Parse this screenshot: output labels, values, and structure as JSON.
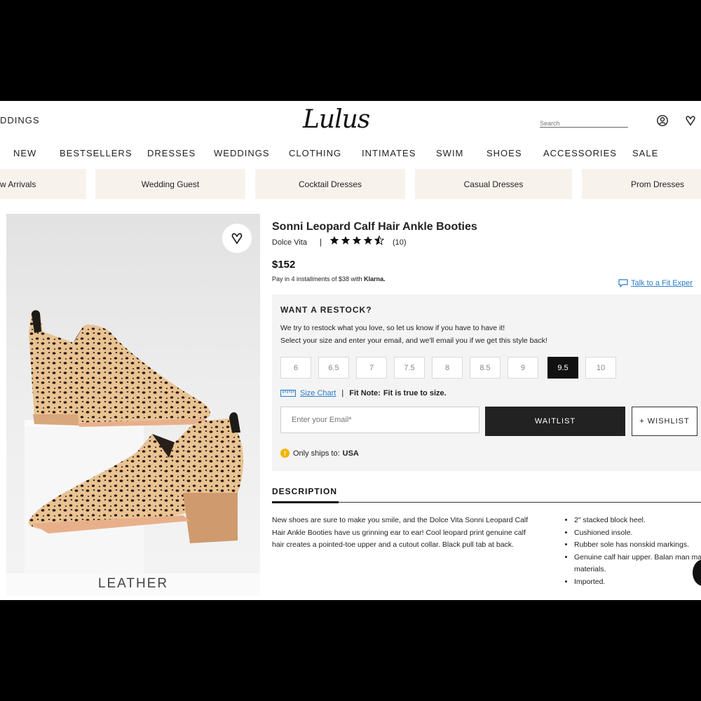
{
  "header": {
    "weddings_link": "DDINGS",
    "logo": "Lulus",
    "search_placeholder": "Search",
    "icons": [
      "account-icon",
      "heart-icon"
    ]
  },
  "nav": {
    "items": [
      "NEW",
      "BESTSELLERS",
      "DRESSES",
      "WEDDINGS",
      "CLOTHING",
      "INTIMATES",
      "SWIM",
      "SHOES",
      "ACCESSORIES",
      "SALE"
    ]
  },
  "chips": [
    "w Arrivals",
    "Wedding Guest",
    "Cocktail Dresses",
    "Casual Dresses",
    "Prom Dresses"
  ],
  "product": {
    "image_label": "LEATHER",
    "title": "Sonni Leopard Calf Hair Ankle Booties",
    "brand": "Dolce Vita",
    "separator": "|",
    "rating": 4.5,
    "review_count": "(10)",
    "price": "$152",
    "klarna_text": "Pay in 4 installments of $38 with",
    "klarna_brand": "Klarna.",
    "fit_expert": "Talk to a Fit Exper"
  },
  "restock": {
    "title": "WANT A RESTOCK?",
    "line1": "We try to restock what you love, so let us know if you have to have it!",
    "line2": "Select your size and enter your email, and we'll email you if we get this style back!",
    "sizes": [
      "6",
      "6.5",
      "7",
      "7.5",
      "8",
      "8.5",
      "9",
      "9.5",
      "10"
    ],
    "selected_size": "9.5",
    "size_chart": "Size Chart",
    "separator": "|",
    "fit_note_label": "Fit Note:",
    "fit_note": "Fit is true to size.",
    "email_placeholder": "Enter your Email*",
    "waitlist": "WAITLIST",
    "wishlist": "+ WISHLIST",
    "ships_text": "Only ships to:",
    "ships_country": "USA"
  },
  "description": {
    "tab": "DESCRIPTION",
    "body": "New shoes are sure to make you smile, and the Dolce Vita Sonni Leopard Calf Hair Ankle Booties have us grinning ear to ear! Cool leopard print genuine calf hair creates a pointed-toe upper and a cutout collar. Black pull tab at back.",
    "bullets": [
      "2\" stacked block heel.",
      "Cushioned insole.",
      "Rubber sole has nonskid markings.",
      "Genuine calf hair upper. Balan man made materials.",
      "Imported."
    ]
  },
  "colors": {
    "chip_bg": "#f8f2ed",
    "panel_bg": "#f4f4f4",
    "link": "#2a7cc7",
    "selected_size_bg": "#111111",
    "alert": "#f2b600"
  }
}
